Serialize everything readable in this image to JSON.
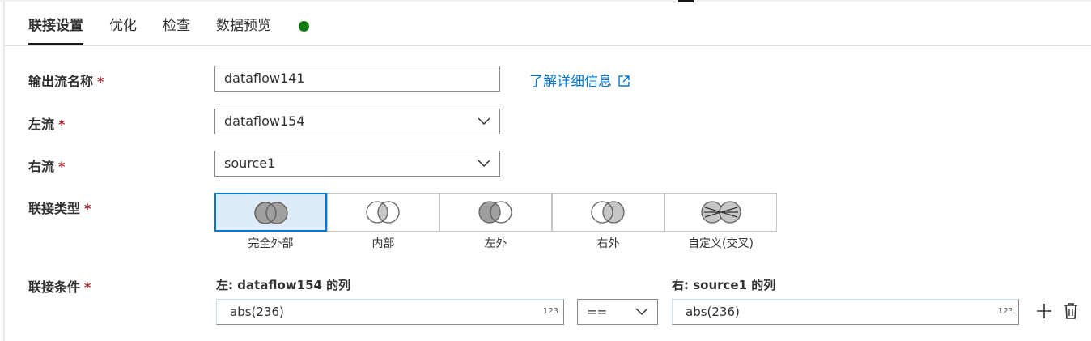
{
  "tabs": [
    {
      "label": "联接设置",
      "active": true
    },
    {
      "label": "优化",
      "active": false
    },
    {
      "label": "检查",
      "active": false
    },
    {
      "label": "数据预览",
      "active": false
    }
  ],
  "status": {
    "color": "#107c10"
  },
  "form": {
    "required_marker": "*",
    "output_name": {
      "label": "输出流名称",
      "value": "dataflow141"
    },
    "learn_more": "了解详细信息",
    "left_stream": {
      "label": "左流",
      "value": "dataflow154"
    },
    "right_stream": {
      "label": "右流",
      "value": "source1"
    },
    "join_type": {
      "label": "联接类型",
      "options": [
        {
          "label": "完全外部",
          "selected": true
        },
        {
          "label": "内部",
          "selected": false
        },
        {
          "label": "左外",
          "selected": false
        },
        {
          "label": "右外",
          "selected": false
        },
        {
          "label": "自定义(交叉)",
          "selected": false
        }
      ]
    },
    "join_conditions": {
      "label": "联接条件",
      "left_header": "左: dataflow154 的列",
      "right_header": "右: source1 的列",
      "left_value": "abs(236)",
      "right_value": "abs(236)",
      "type_badge": "123",
      "operator": "=="
    }
  },
  "colors": {
    "accent": "#0078d4",
    "required": "#a4262c",
    "selected_bg": "#deecf9"
  },
  "icons": [
    "external-link-icon",
    "chevron-down-icon",
    "add-icon",
    "delete-icon"
  ]
}
